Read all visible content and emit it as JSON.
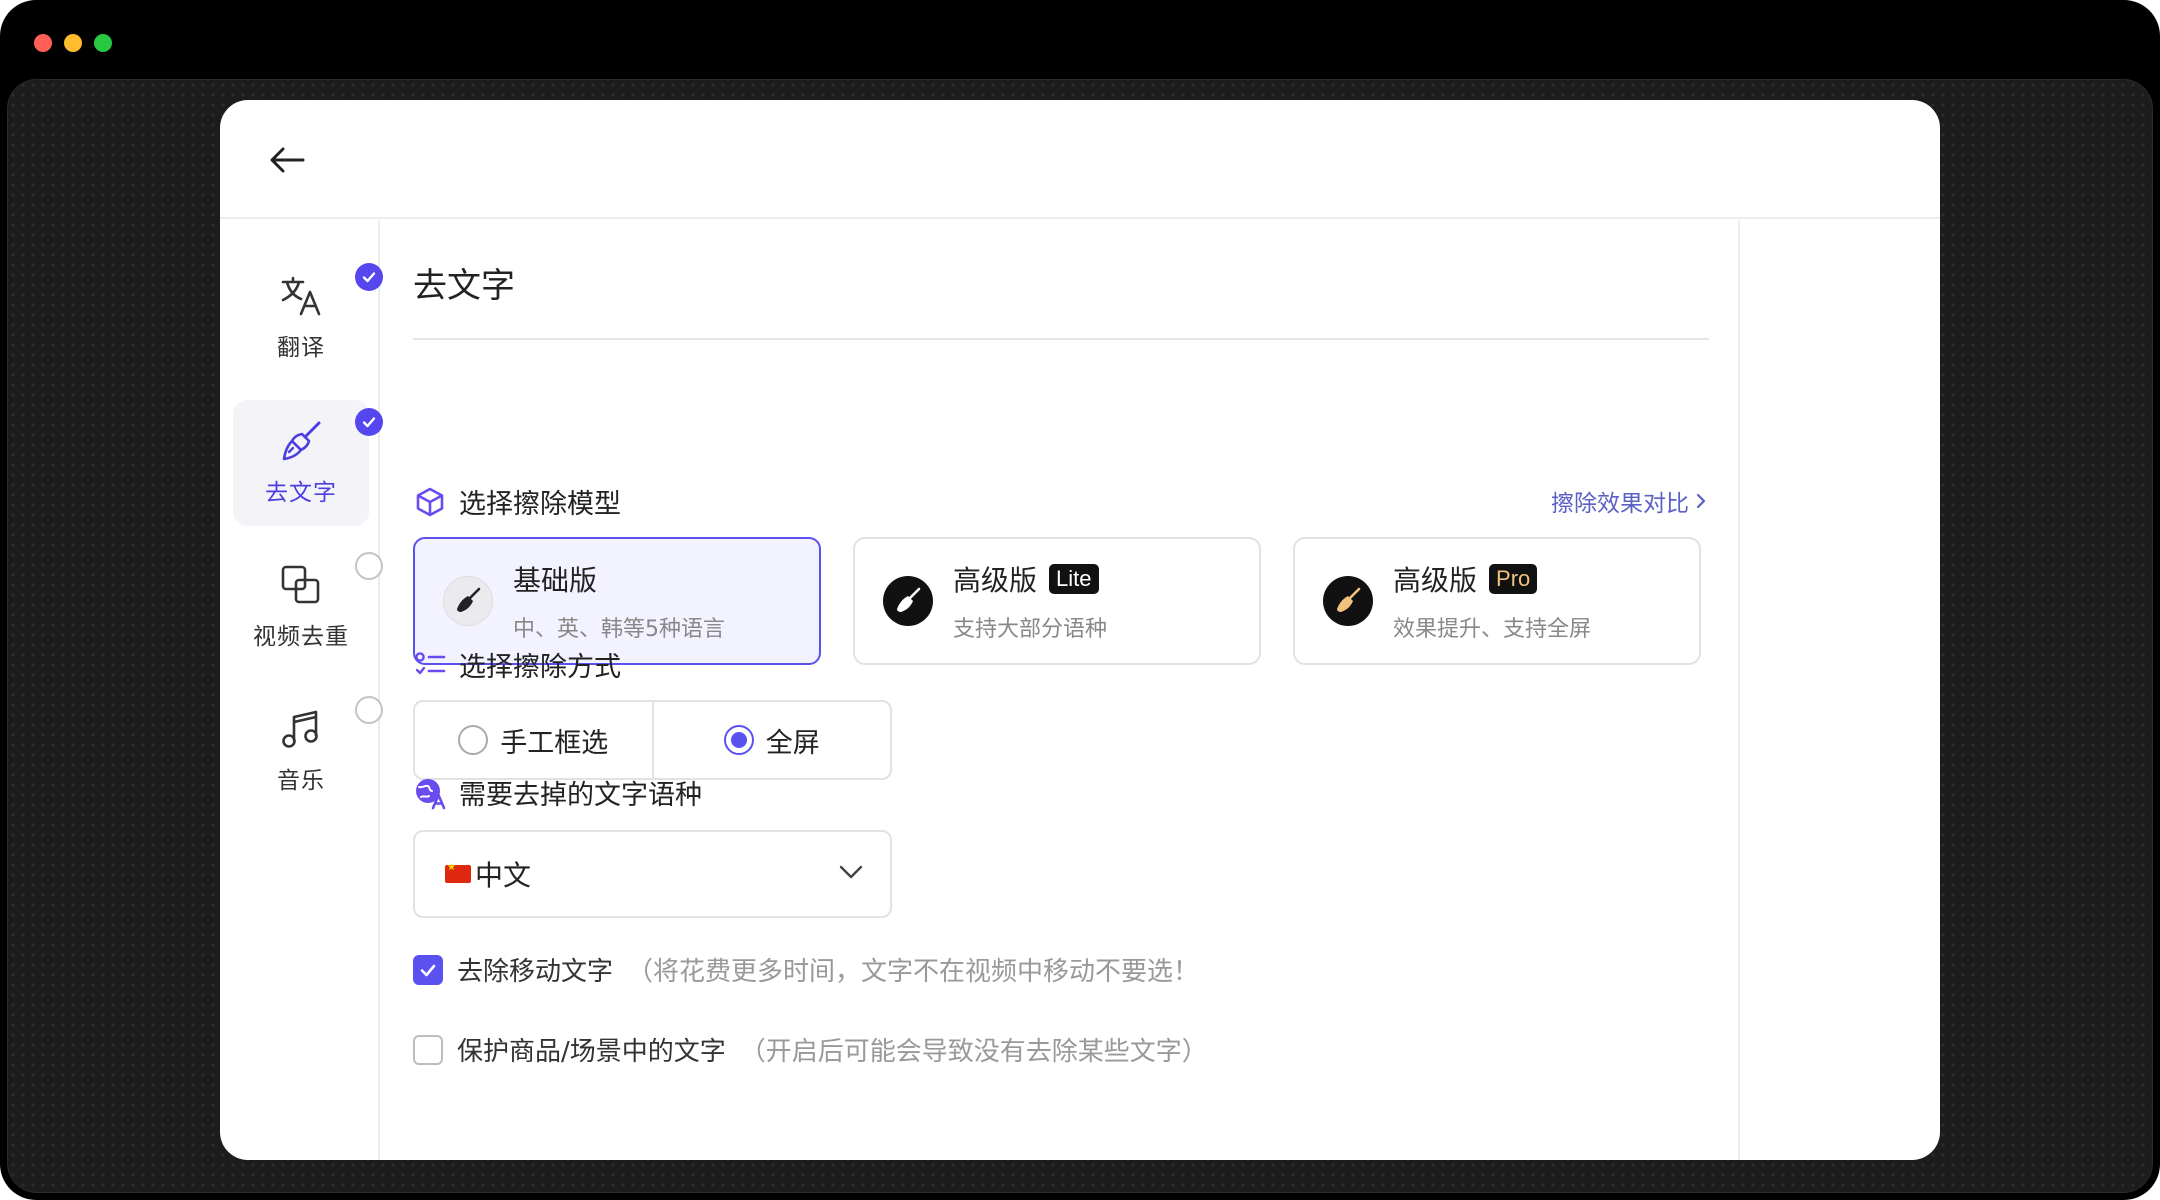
{
  "window": {
    "traffic_lights": [
      "#ff5f57",
      "#febc2e",
      "#28c840"
    ],
    "back_icon": "arrow-left-icon"
  },
  "sidebar": {
    "items": [
      {
        "label": "翻译",
        "icon": "translate-icon",
        "status": "checked"
      },
      {
        "label": "去文字",
        "icon": "broom-icon",
        "status": "checked",
        "active": true
      },
      {
        "label": "视频去重",
        "icon": "copy-icon",
        "status": "unchecked"
      },
      {
        "label": "音乐",
        "icon": "music-note-icon",
        "status": "unchecked"
      }
    ]
  },
  "main": {
    "title": "去文字",
    "model_section": {
      "heading": "选择擦除模型",
      "compare_link": "擦除效果对比",
      "cards": [
        {
          "title": "基础版",
          "badge": "",
          "subtitle": "中、英、韩等5种语言",
          "selected": true
        },
        {
          "title": "高级版",
          "badge": "Lite",
          "subtitle": "支持大部分语种",
          "selected": false
        },
        {
          "title": "高级版",
          "badge": "Pro",
          "subtitle": "效果提升、支持全屏",
          "selected": false
        }
      ]
    },
    "mode_section": {
      "heading": "选择擦除方式",
      "options": [
        {
          "label": "手工框选",
          "selected": false
        },
        {
          "label": "全屏",
          "selected": true
        }
      ]
    },
    "language_section": {
      "heading": "需要去掉的文字语种",
      "selected": "中文"
    },
    "options": [
      {
        "label": "去除移动文字",
        "hint": "（将花费更多时间，文字不在视频中移动不要选！",
        "checked": true
      },
      {
        "label": "保护商品/场景中的文字",
        "hint": "（开启后可能会导致没有去除某些文字）",
        "checked": false
      }
    ]
  },
  "colors": {
    "accent": "#5b50f0",
    "link": "#5b5fc7",
    "pro_badge_text": "#f1c27a"
  }
}
